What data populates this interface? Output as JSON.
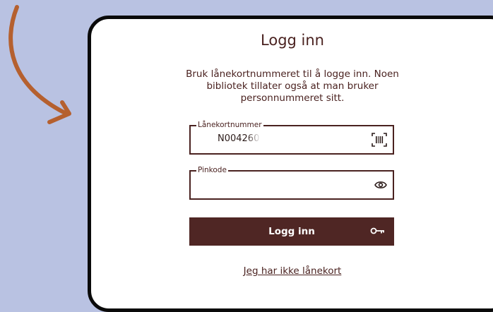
{
  "login": {
    "title": "Logg inn",
    "description": "Bruk lånekortnummeret til å logge inn. Noen bibliotek tillater også at man bruker personnummeret sitt.",
    "card_number_label": "Lånekortnummer",
    "card_number_value": "N004260",
    "pin_label": "Pinkode",
    "pin_value": "",
    "submit_label": "Logg inn",
    "no_card_link": "Jeg har ikke lånekort"
  },
  "icons": {
    "barcode": "barcode-icon",
    "eye": "eye-icon",
    "key": "key-icon",
    "arrow": "curved-arrow-icon"
  },
  "colors": {
    "background": "#b9c2e2",
    "brand": "#4f2624",
    "arrow": "#b5602f",
    "card_border": "#0a0a0a"
  }
}
